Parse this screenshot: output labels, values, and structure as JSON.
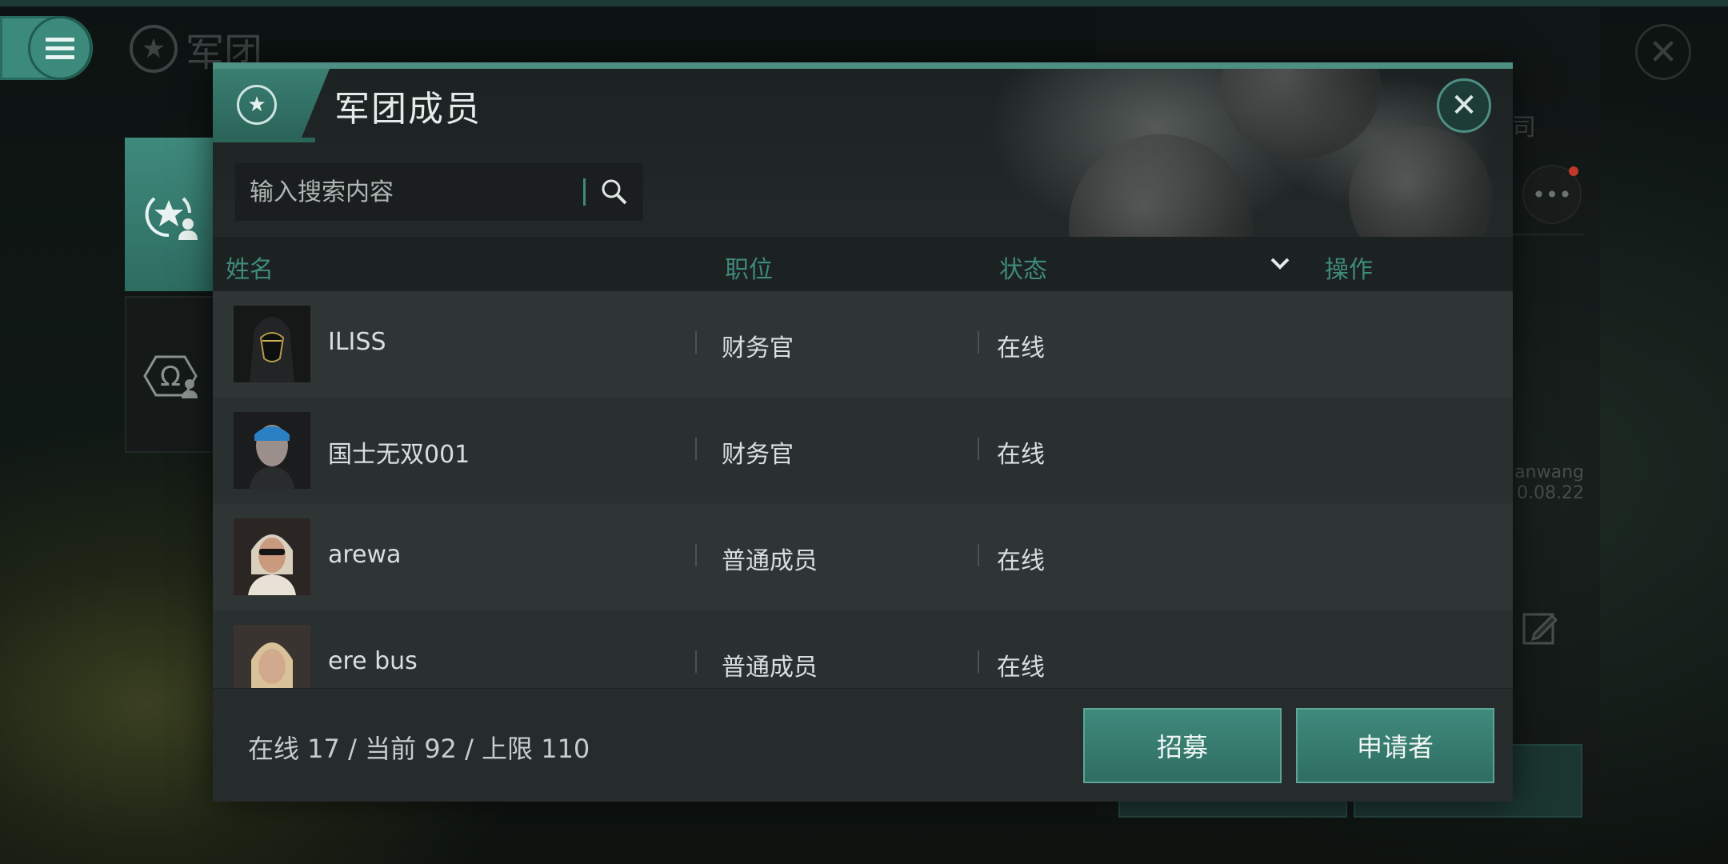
{
  "background": {
    "page_title": "军团",
    "company_label": "公司",
    "user_name_partial": "anwang",
    "user_date_partial": "0.08.22"
  },
  "modal": {
    "title": "军团成员",
    "search": {
      "placeholder": "输入搜索内容",
      "value": ""
    },
    "columns": {
      "name": "姓名",
      "position": "职位",
      "status": "状态",
      "action": "操作"
    },
    "members": [
      {
        "name": "ILISS",
        "position": "财务官",
        "status": "在线"
      },
      {
        "name": "国士无双001",
        "position": "财务官",
        "status": "在线"
      },
      {
        "name": "arewa",
        "position": "普通成员",
        "status": "在线"
      },
      {
        "name": "ere bus",
        "position": "普通成员",
        "status": "在线"
      }
    ],
    "footer": {
      "count_text": "在线 17 / 当前 92 / 上限 110",
      "recruit_label": "招募",
      "applicants_label": "申请者"
    }
  },
  "colors": {
    "accent": "#3f8a7c",
    "panel": "#262b2b",
    "header_text": "#3f8a7c"
  },
  "icons": [
    "menu-icon",
    "corporation-star-icon",
    "alliance-omega-icon",
    "close-icon",
    "search-icon",
    "sort-chevron-icon",
    "edit-icon",
    "more-icon"
  ]
}
